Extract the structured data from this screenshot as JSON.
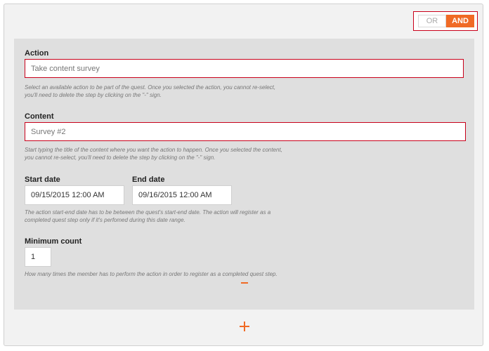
{
  "toggle": {
    "or_label": "OR",
    "and_label": "AND",
    "selected": "AND"
  },
  "action": {
    "label": "Action",
    "value": "Take content survey",
    "help_line1": "Select an available action to be part of the quest. Once you selected the action, you cannot re-select,",
    "help_line2": "you'll need to delete the step by clicking on the \"-\" sign."
  },
  "content": {
    "label": "Content",
    "value": "Survey #2",
    "help_line1": "Start typing the title of the content where you want the action to happen. Once you selected the content,",
    "help_line2": "you cannot re-select, you'll need to delete the step by clicking on the \"-\" sign."
  },
  "start_date": {
    "label": "Start date",
    "value": "09/15/2015 12:00 AM"
  },
  "end_date": {
    "label": "End date",
    "value": "09/16/2015 12:00 AM"
  },
  "dates_help": {
    "line1": "The action start-end date has to be between the quest's start-end date. The action will register as a",
    "line2": "completed quest step only if it's perfomed during this date range."
  },
  "minimum_count": {
    "label": "Minimum count",
    "value": "1",
    "help": "How many times the member has to perform the action in order to register as a completed quest step."
  },
  "icons": {
    "remove": "minus-icon",
    "add": "plus-icon"
  },
  "colors": {
    "accent": "#f06a25",
    "error_border": "#c9001a",
    "panel_bg": "#dfdfdf"
  }
}
